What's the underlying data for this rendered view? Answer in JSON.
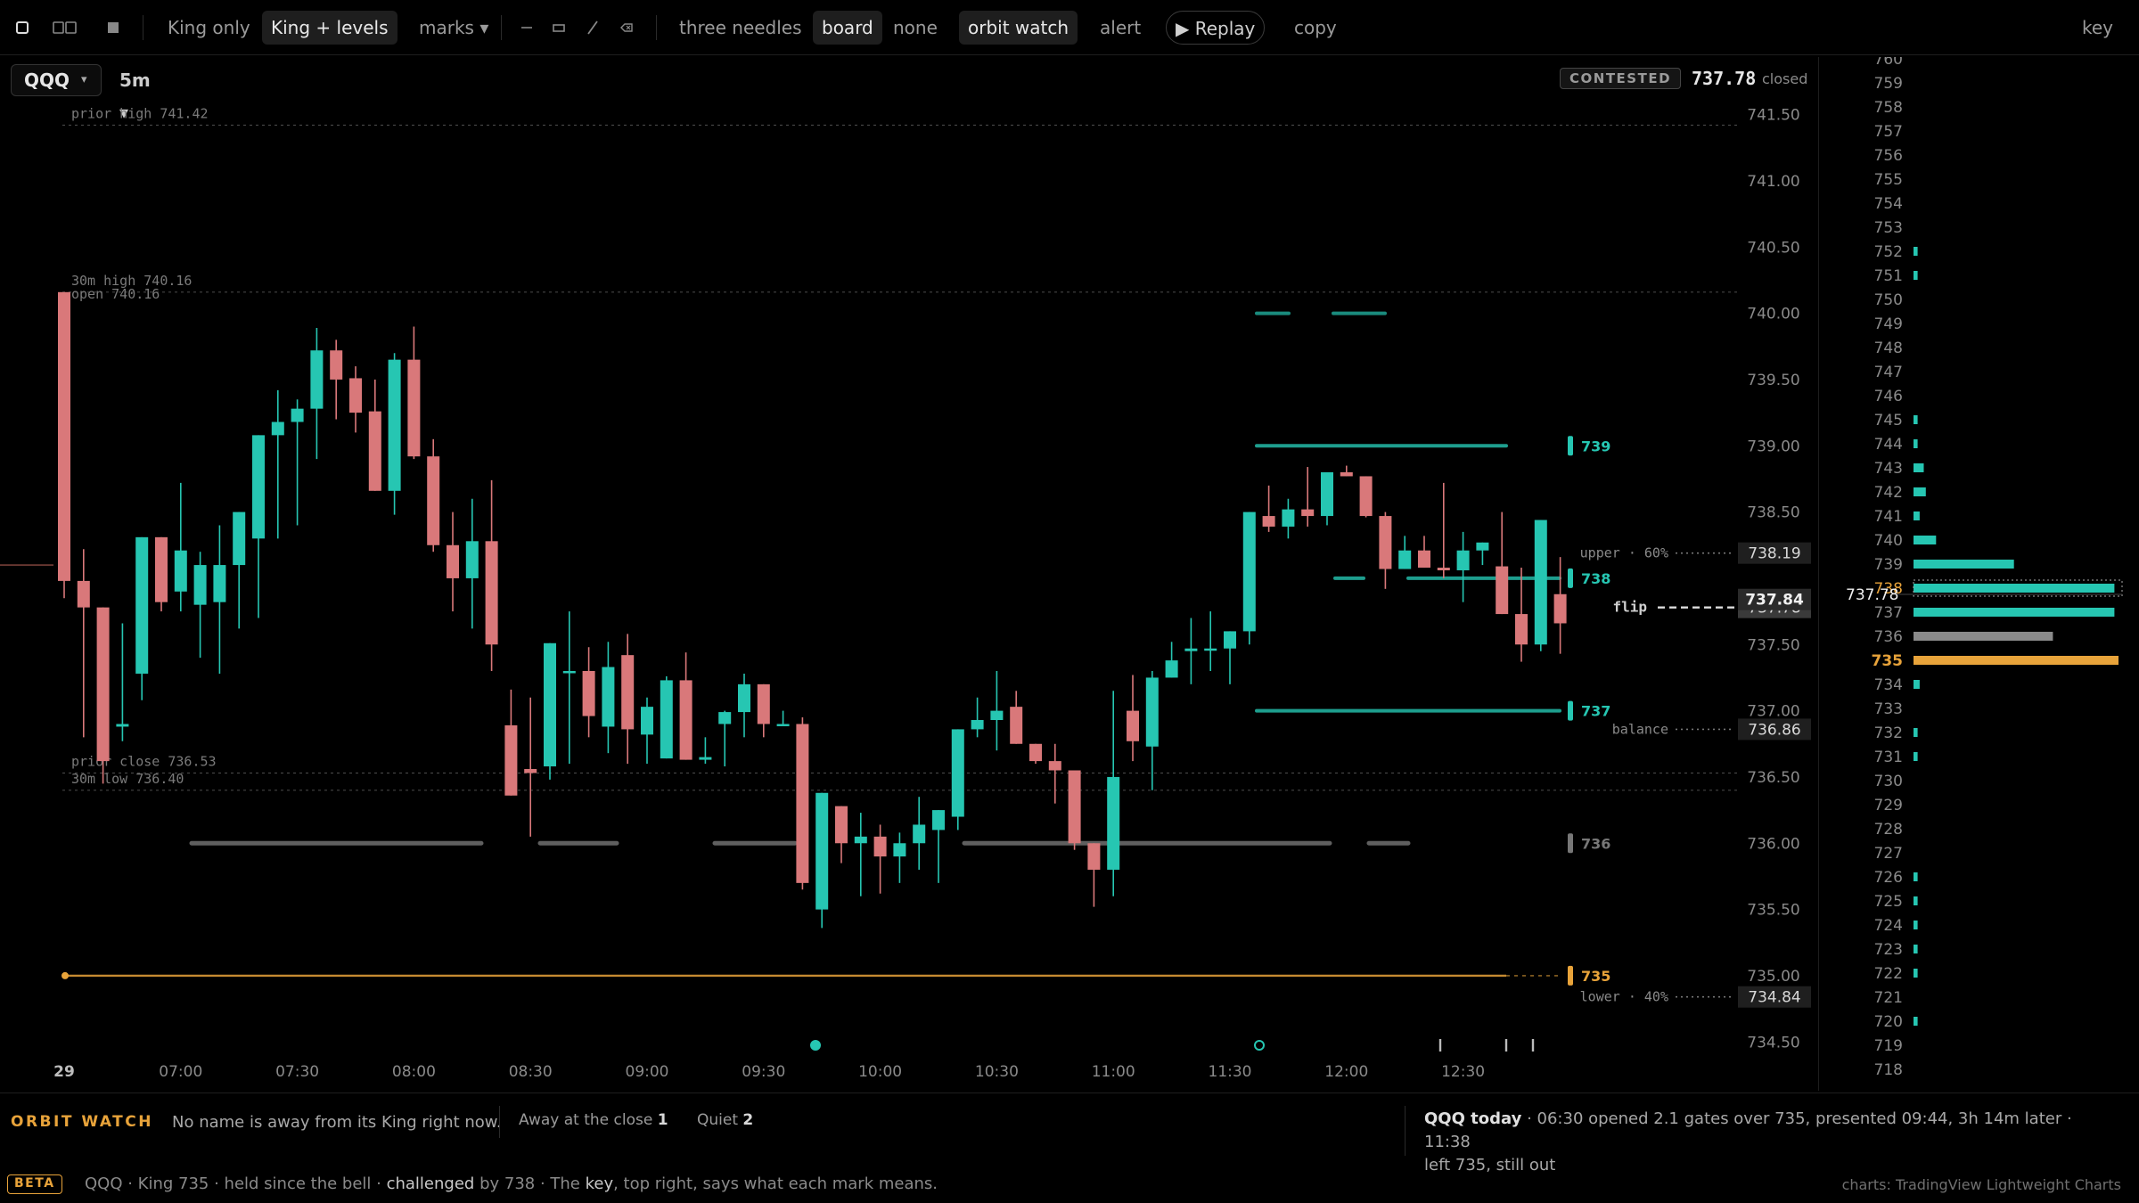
{
  "toolbar": {
    "layouts": [
      {
        "name": "single-layout-icon"
      },
      {
        "name": "split-layout-icon"
      },
      {
        "name": "grid-layout-icon"
      }
    ],
    "view_modes": [
      "King only",
      "King + levels"
    ],
    "active_view": 1,
    "marks_label": "marks ▾",
    "draw_tools": [
      "horizontal-line-icon",
      "rectangle-icon",
      "trend-line-icon",
      "eraser-icon"
    ],
    "overlay_modes": [
      "three needles",
      "board",
      "none"
    ],
    "active_overlay": 1,
    "orbit_watch_label": "orbit watch",
    "alert_label": "alert",
    "replay_label": "▶ Replay",
    "copy_label": "copy",
    "key_label": "key"
  },
  "symbol": "QQQ",
  "symbol_caret": "▾",
  "interval": "5m ▾",
  "status": {
    "badge": "CONTESTED",
    "price": "737.78",
    "state": "closed"
  },
  "colors": {
    "up": "#26c6b2",
    "down": "#d9787a",
    "king": "#e8a33a",
    "grey": "#777777",
    "bg": "#000000"
  },
  "chart_data": {
    "type": "candlestick",
    "symbol": "QQQ",
    "interval": "5m",
    "ylim": [
      734.3,
      741.8
    ],
    "y_ticks": [
      "741.50",
      "741.00",
      "740.50",
      "740.00",
      "739.50",
      "739.00",
      "738.50",
      "737.50",
      "737.00",
      "736.50",
      "736.00",
      "735.50",
      "735.00",
      "734.50"
    ],
    "x_ticks": [
      {
        "label": "29",
        "bar": 0
      },
      {
        "label": "07:00",
        "bar": 6
      },
      {
        "label": "07:30",
        "bar": 12
      },
      {
        "label": "08:00",
        "bar": 18
      },
      {
        "label": "08:30",
        "bar": 24
      },
      {
        "label": "09:00",
        "bar": 30
      },
      {
        "label": "09:30",
        "bar": 36
      },
      {
        "label": "10:00",
        "bar": 42
      },
      {
        "label": "10:30",
        "bar": 48
      },
      {
        "label": "11:00",
        "bar": 54
      },
      {
        "label": "11:30",
        "bar": 60
      },
      {
        "label": "12:00",
        "bar": 66
      },
      {
        "label": "12:30",
        "bar": 72
      }
    ],
    "ohlc": [
      [
        740.16,
        740.16,
        737.85,
        737.98
      ],
      [
        737.98,
        738.22,
        736.8,
        737.78
      ],
      [
        737.78,
        737.78,
        736.45,
        736.62
      ],
      [
        736.88,
        737.66,
        736.77,
        736.9
      ],
      [
        737.28,
        738.22,
        737.08,
        738.31
      ],
      [
        738.31,
        738.3,
        737.75,
        737.82
      ],
      [
        737.9,
        738.72,
        737.75,
        738.21
      ],
      [
        737.8,
        738.2,
        737.4,
        738.1
      ],
      [
        737.82,
        738.4,
        737.28,
        738.1
      ],
      [
        738.1,
        738.46,
        737.62,
        738.5
      ],
      [
        738.3,
        738.9,
        737.7,
        739.08
      ],
      [
        739.08,
        739.42,
        738.3,
        739.18
      ],
      [
        739.18,
        739.35,
        738.4,
        739.28
      ],
      [
        739.28,
        739.89,
        738.9,
        739.72
      ],
      [
        739.72,
        739.8,
        739.2,
        739.5
      ],
      [
        739.51,
        739.6,
        739.1,
        739.25
      ],
      [
        739.26,
        739.5,
        738.7,
        738.66
      ],
      [
        738.66,
        739.7,
        738.48,
        739.65
      ],
      [
        739.65,
        739.9,
        738.9,
        738.92
      ],
      [
        738.92,
        739.05,
        738.2,
        738.25
      ],
      [
        738.25,
        738.5,
        737.75,
        738.0
      ],
      [
        738.0,
        738.6,
        737.62,
        738.28
      ],
      [
        738.28,
        738.74,
        737.3,
        737.5
      ],
      [
        736.89,
        737.16,
        736.54,
        736.36
      ],
      [
        736.56,
        737.1,
        736.05,
        736.53
      ],
      [
        736.58,
        737.51,
        736.48,
        737.51
      ],
      [
        737.3,
        737.75,
        736.6,
        737.3
      ],
      [
        737.3,
        737.48,
        736.8,
        736.96
      ],
      [
        736.88,
        737.52,
        736.68,
        737.33
      ],
      [
        737.42,
        737.58,
        736.6,
        736.86
      ],
      [
        736.82,
        737.1,
        736.6,
        737.03
      ],
      [
        736.64,
        737.26,
        736.72,
        737.23
      ],
      [
        737.23,
        737.44,
        736.63,
        736.63
      ],
      [
        736.63,
        736.8,
        736.6,
        736.65
      ],
      [
        736.9,
        737.0,
        736.58,
        736.99
      ],
      [
        736.99,
        737.28,
        736.8,
        737.2
      ],
      [
        737.2,
        737.15,
        736.8,
        736.9
      ],
      [
        736.9,
        737.0,
        736.9,
        736.9
      ],
      [
        736.9,
        736.95,
        735.65,
        735.7
      ],
      [
        735.5,
        736.14,
        735.36,
        736.38
      ],
      [
        736.28,
        736.1,
        735.85,
        736.0
      ],
      [
        736.0,
        736.23,
        735.6,
        736.05
      ],
      [
        736.05,
        736.14,
        735.62,
        735.9
      ],
      [
        735.9,
        736.08,
        735.7,
        736.0
      ],
      [
        736.0,
        736.35,
        735.8,
        736.14
      ],
      [
        736.1,
        736.18,
        735.7,
        736.25
      ],
      [
        736.2,
        736.8,
        736.1,
        736.86
      ],
      [
        736.86,
        737.1,
        736.8,
        736.93
      ],
      [
        736.93,
        737.3,
        736.7,
        737.0
      ],
      [
        737.03,
        737.15,
        736.8,
        736.75
      ],
      [
        736.75,
        736.65,
        736.6,
        736.62
      ],
      [
        736.62,
        736.75,
        736.3,
        736.55
      ],
      [
        736.55,
        736.5,
        735.95,
        736.0
      ],
      [
        736.0,
        736.0,
        735.52,
        735.8
      ],
      [
        735.8,
        737.15,
        735.6,
        736.5
      ],
      [
        737.0,
        737.27,
        736.62,
        736.77
      ],
      [
        736.73,
        737.3,
        736.4,
        737.25
      ],
      [
        737.25,
        737.52,
        737.3,
        737.38
      ],
      [
        737.45,
        737.7,
        737.2,
        737.47
      ],
      [
        737.47,
        737.75,
        737.3,
        737.47
      ],
      [
        737.47,
        737.57,
        737.2,
        737.6
      ],
      [
        737.6,
        738.45,
        737.5,
        738.5
      ],
      [
        738.47,
        738.7,
        738.35,
        738.39
      ],
      [
        738.39,
        738.6,
        738.3,
        738.52
      ],
      [
        738.52,
        738.84,
        738.39,
        738.47
      ],
      [
        738.47,
        738.62,
        738.4,
        738.8
      ],
      [
        738.8,
        738.85,
        738.78,
        738.77
      ],
      [
        738.77,
        738.69,
        738.46,
        738.47
      ],
      [
        738.47,
        738.5,
        737.92,
        738.07
      ],
      [
        738.07,
        738.32,
        738.07,
        738.21
      ],
      [
        738.21,
        738.32,
        738.09,
        738.08
      ],
      [
        738.08,
        738.72,
        738.0,
        738.06
      ],
      [
        738.06,
        738.35,
        737.82,
        738.21
      ],
      [
        738.21,
        738.23,
        738.1,
        738.27
      ],
      [
        738.09,
        738.5,
        737.92,
        737.73
      ],
      [
        737.73,
        738.08,
        737.37,
        737.5
      ],
      [
        737.5,
        738.38,
        737.45,
        738.44
      ],
      [
        737.88,
        738.16,
        737.43,
        737.66
      ]
    ],
    "reference_lines": [
      {
        "label": "prior high 741.42",
        "value": 741.42
      },
      {
        "label": "30m high 740.16",
        "value": 740.16
      },
      {
        "label": "open 740.16",
        "value": 740.16
      },
      {
        "label": "prior close 736.53",
        "value": 736.53
      },
      {
        "label": "30m low 736.40",
        "value": 736.4
      }
    ],
    "king_levels": [
      {
        "label": "739",
        "value": 739,
        "type": "up"
      },
      {
        "label": "738",
        "value": 738,
        "type": "up"
      },
      {
        "label": "737",
        "value": 737,
        "type": "up"
      },
      {
        "label": "736",
        "value": 736,
        "type": "grey"
      },
      {
        "label": "735",
        "value": 735,
        "type": "king"
      }
    ],
    "axis_markers": [
      {
        "label": "upper · 60%",
        "price": "738.19",
        "value": 738.19
      },
      {
        "label": "flip",
        "price": "737.78",
        "value": 737.78
      },
      {
        "label": "balance",
        "price": "736.86",
        "value": 736.86
      },
      {
        "label": "lower · 40%",
        "price": "734.84",
        "value": 734.84
      }
    ],
    "last_price": {
      "value": "737.78",
      "prev": "737.84"
    }
  },
  "ladder": {
    "current": "737.78",
    "rows": [
      {
        "strike": "760",
        "value": 0
      },
      {
        "strike": "759",
        "value": 0
      },
      {
        "strike": "758",
        "value": 0
      },
      {
        "strike": "757",
        "value": 0
      },
      {
        "strike": "756",
        "value": 0
      },
      {
        "strike": "755",
        "value": 0
      },
      {
        "strike": "754",
        "value": 0
      },
      {
        "strike": "753",
        "value": 0
      },
      {
        "strike": "752",
        "value": 0.02
      },
      {
        "strike": "751",
        "value": 0.02
      },
      {
        "strike": "750",
        "value": 0
      },
      {
        "strike": "749",
        "value": 0
      },
      {
        "strike": "748",
        "value": 0
      },
      {
        "strike": "747",
        "value": 0
      },
      {
        "strike": "746",
        "value": 0
      },
      {
        "strike": "745",
        "value": 0.02
      },
      {
        "strike": "744",
        "value": 0.02
      },
      {
        "strike": "743",
        "value": 0.05
      },
      {
        "strike": "742",
        "value": 0.06
      },
      {
        "strike": "741",
        "value": 0.03
      },
      {
        "strike": "740",
        "value": 0.11
      },
      {
        "strike": "739",
        "value": 0.49
      },
      {
        "strike": "738",
        "value": 0.98
      },
      {
        "strike": "737",
        "value": 0.98
      },
      {
        "strike": "736",
        "value": 0.68
      },
      {
        "strike": "735",
        "value": 1.0
      },
      {
        "strike": "734",
        "value": 0.03
      },
      {
        "strike": "733",
        "value": 0
      },
      {
        "strike": "732",
        "value": 0.02
      },
      {
        "strike": "731",
        "value": 0.02
      },
      {
        "strike": "730",
        "value": 0
      },
      {
        "strike": "729",
        "value": 0
      },
      {
        "strike": "728",
        "value": 0
      },
      {
        "strike": "727",
        "value": 0
      },
      {
        "strike": "726",
        "value": 0.02
      },
      {
        "strike": "725",
        "value": 0.02
      },
      {
        "strike": "724",
        "value": 0.02
      },
      {
        "strike": "723",
        "value": 0.02
      },
      {
        "strike": "722",
        "value": 0.02
      },
      {
        "strike": "721",
        "value": 0
      },
      {
        "strike": "720",
        "value": 0.02
      },
      {
        "strike": "719",
        "value": 0
      },
      {
        "strike": "718",
        "value": 0
      }
    ]
  },
  "orbit": {
    "title": "ORBIT WATCH",
    "message": "No name is away from its King right now.",
    "away_label": "Away at the close",
    "away_count": "1",
    "quiet_label": "Quiet",
    "quiet_count": "2"
  },
  "today": {
    "title": "QQQ today",
    "line1": " · 06:30 opened 2.1 gates over 735, presented 09:44, 3h 14m later · 11:38",
    "line2": "left 735, still out"
  },
  "footer": {
    "beta": "BETA",
    "pre": "QQQ · King 735 · held since the bell · ",
    "challenged": "challenged",
    "mid": " by 738 · The ",
    "key_word": "key",
    "post": ", top right, says what each mark means.",
    "credit": "charts: TradingView Lightweight Charts"
  }
}
